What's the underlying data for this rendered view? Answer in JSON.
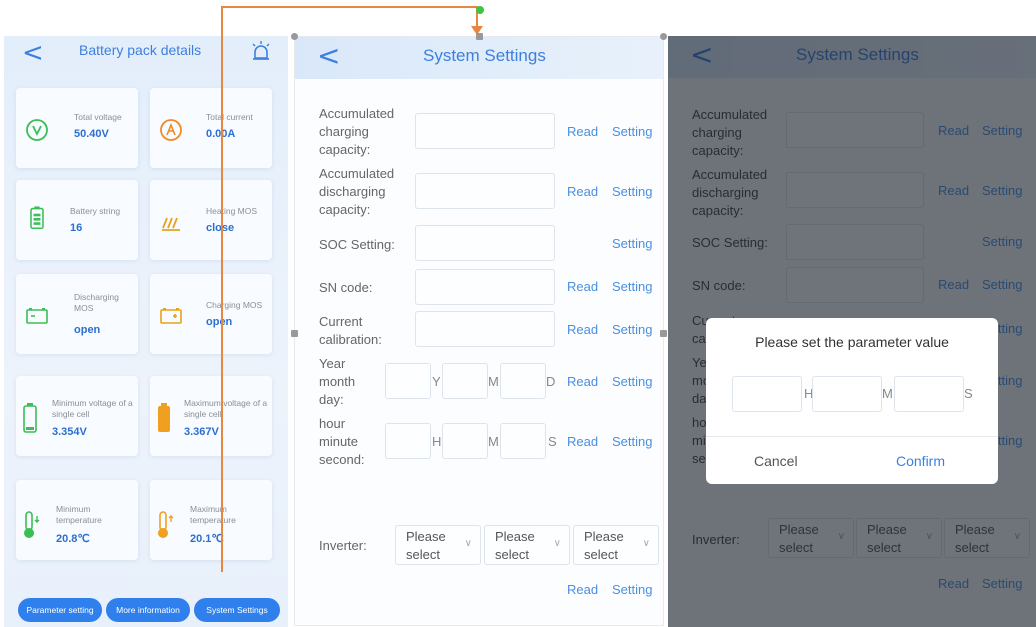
{
  "screen1": {
    "title": "Battery pack details",
    "cards": [
      {
        "label": "Total voltage",
        "value": "50.40V",
        "icon": "voltage-icon"
      },
      {
        "label": "Total current",
        "value": "0.00A",
        "icon": "current-icon"
      },
      {
        "label": "Battery string",
        "value": "16",
        "icon": "battery-icon"
      },
      {
        "label": "Heating MOS",
        "value": "close",
        "icon": "heating-icon"
      },
      {
        "label": "Discharging MOS",
        "value": "open",
        "icon": "discharge-battery-icon"
      },
      {
        "label": "Charging MOS",
        "value": "open",
        "icon": "charge-battery-icon"
      },
      {
        "label": "Minimum voltage of a single cell",
        "value": "3.354V",
        "icon": "cell-min-icon"
      },
      {
        "label": "Maximum voltage of a single cell",
        "value": "3.367V",
        "icon": "cell-max-icon"
      },
      {
        "label": "Minimum temperature",
        "value": "20.8℃",
        "icon": "thermometer-down-icon"
      },
      {
        "label": "Maximum temperature",
        "value": "20.1℃",
        "icon": "thermometer-up-icon"
      }
    ],
    "buttons": [
      "Parameter setting",
      "More information",
      "System Settings"
    ]
  },
  "screen2": {
    "title": "System Settings",
    "labels": {
      "acc_charge": "Accumulated charging capacity:",
      "acc_discharge": "Accumulated discharging capacity:",
      "soc": "SOC Setting:",
      "sn": "SN code:",
      "current_cal": "Current calibration:",
      "ymd": "Year month day:",
      "hms": "hour minute second:",
      "inverter": "Inverter:"
    },
    "read": "Read",
    "setting": "Setting",
    "units": {
      "y": "Y",
      "m": "M",
      "d": "D",
      "h": "H",
      "min": "M",
      "s": "S"
    },
    "select_placeholder": "Please select"
  },
  "screen3": {
    "dialog_title": "Please set the parameter value",
    "units": [
      "H",
      "M",
      "S"
    ],
    "cancel": "Cancel",
    "confirm": "Confirm"
  },
  "colors": {
    "accent": "#3d7fe0",
    "arrow": "#e8873f",
    "button": "#2f80ed"
  }
}
